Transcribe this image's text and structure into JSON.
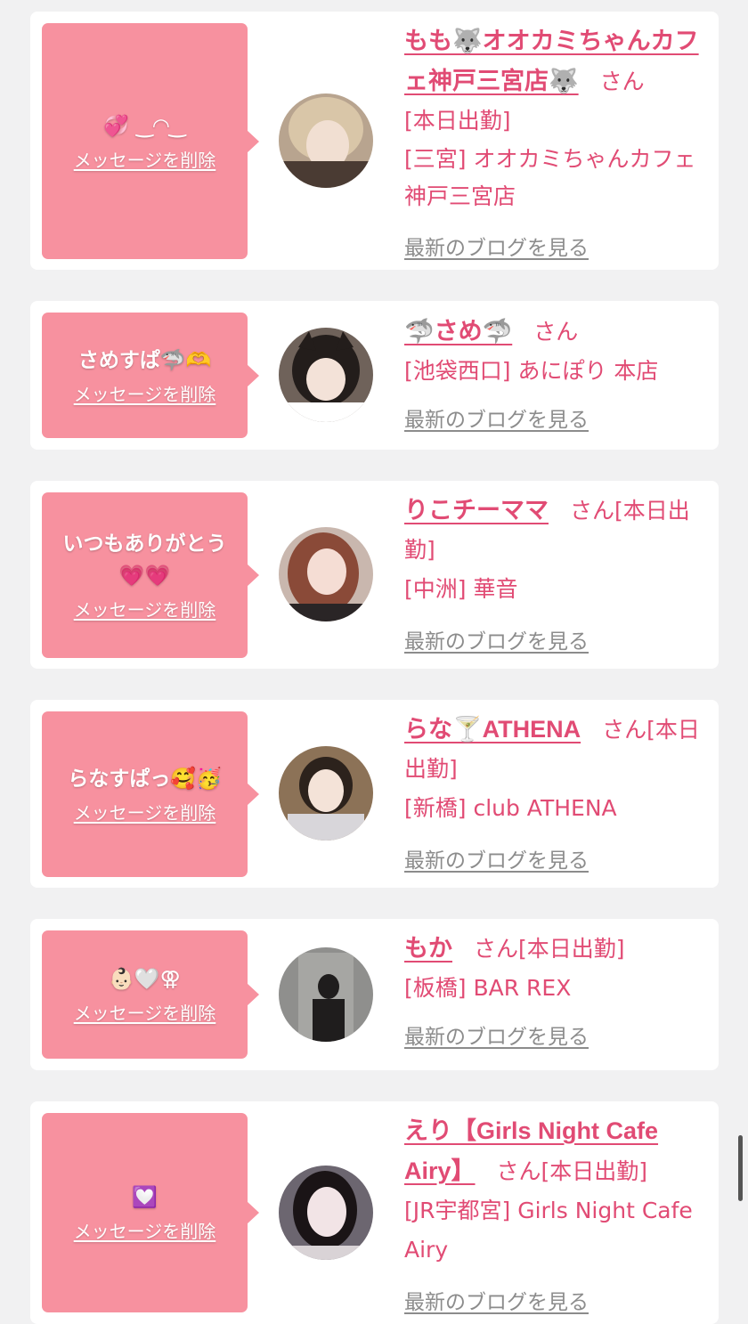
{
  "cards": [
    {
      "message": "💞 ‿◠‿",
      "delete_label": "メッセージを削除",
      "name": "もも🐺オオカミちゃんカフェ神戸三宮店🐺",
      "san": "さん",
      "status": "[本日出勤]",
      "shop": "[三宮] オオカミちゃんカフェ神戸三宮店",
      "blog_label": "最新のブログを見る"
    },
    {
      "message": "さめすぱ🦈🫶",
      "delete_label": "メッセージを削除",
      "name": "🦈さめ🦈",
      "san": "さん",
      "shop": "[池袋西口] あにぽり 本店",
      "blog_label": "最新のブログを見る"
    },
    {
      "message": "いつもありがとう💗💗",
      "delete_label": "メッセージを削除",
      "name": "りこチーママ",
      "san": "さん",
      "status": "[本日出勤]",
      "shop": "[中洲] 華音",
      "blog_label": "最新のブログを見る"
    },
    {
      "message": "らなすぱっ🥰🥳",
      "delete_label": "メッセージを削除",
      "name": "らな🍸ATHENA",
      "san": "さん",
      "status": "[本日出勤]",
      "shop": "[新橋] club ATHENA",
      "blog_label": "最新のブログを見る"
    },
    {
      "message": "👶🏻🤍⚢",
      "delete_label": "メッセージを削除",
      "name": "もか",
      "san": "さん",
      "status": "[本日出勤]",
      "shop": "[板橋] BAR REX",
      "blog_label": "最新のブログを見る"
    },
    {
      "message": "💟",
      "delete_label": "メッセージを削除",
      "name": "えり【Girls Night Cafe Airy】",
      "san": "さん",
      "status": "[本日出勤]",
      "shop": "[JR宇都宮] Girls Night Cafe Airy",
      "blog_label": "最新のブログを見る"
    }
  ],
  "colors": {
    "page_bg": "#f1f1f2",
    "bubble": "#f7919f",
    "accent_text": "#e14b74",
    "blog_link": "#8c8c8c"
  }
}
